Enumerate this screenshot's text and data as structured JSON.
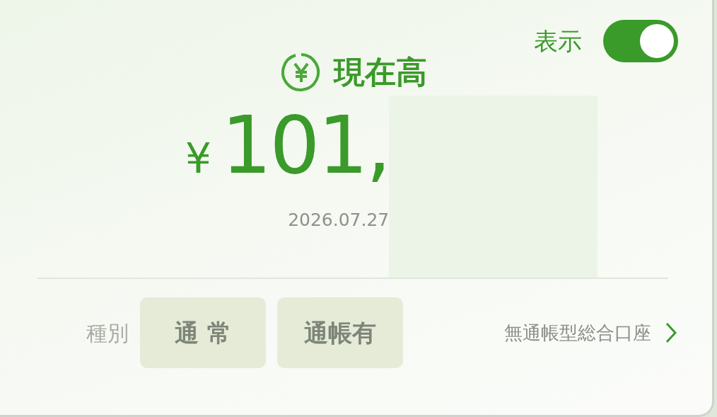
{
  "display_toggle": {
    "label": "表示",
    "on": true
  },
  "title": "現在高",
  "balance": {
    "currency": "¥",
    "amount": "101,",
    "date": "2026.07.27"
  },
  "type_row": {
    "label": "種別",
    "tags": [
      "通 常",
      "通帳有"
    ],
    "link": "無通帳型総合口座"
  }
}
